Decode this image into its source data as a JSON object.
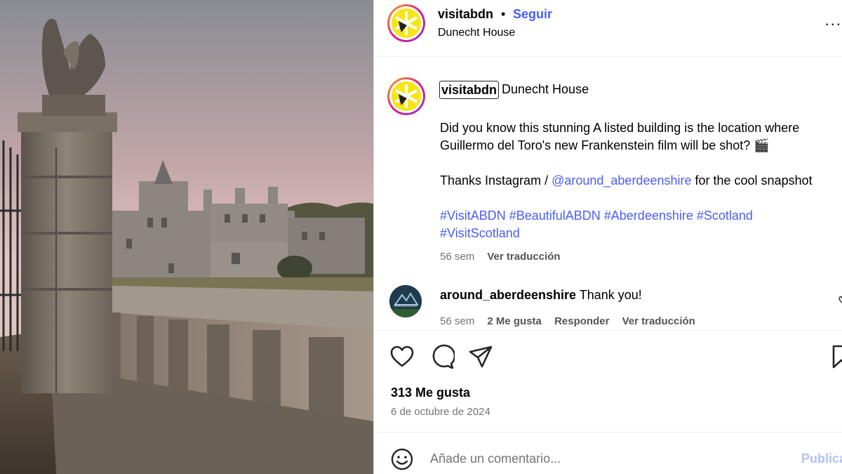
{
  "post": {
    "header": {
      "username": "visitabdn",
      "separator": "•",
      "follow_label": "Seguir",
      "location": "Dunecht House",
      "more_label": "..."
    },
    "caption": {
      "username": "visitabdn",
      "location": "Dunecht House",
      "line1": "Did you know this stunning A listed building is the location where",
      "line2": "Guillermo del Toro's new Frankenstein film will be shot? 🎬",
      "thanks_prefix": "Thanks Instagram / ",
      "mention": "@around_aberdeenshire",
      "thanks_suffix": " for the cool snapshot",
      "hashtags_line1": "#VisitABDN #BeautifulABDN #Aberdeenshire #Scotland",
      "hashtags_line2": "#VisitScotland",
      "time": "56 sem",
      "translate_label": "Ver traducción"
    },
    "comment": {
      "username": "around_aberdeenshire",
      "avatar_label": "Aberdeenshire",
      "text": "Thank you!",
      "time": "56 sem",
      "likes_label": "2 Me gusta",
      "reply_label": "Responder",
      "translate_label": "Ver traducción"
    },
    "actions": {
      "like_icon": "heart-icon",
      "comment_icon": "comment-icon",
      "share_icon": "share-icon",
      "save_icon": "bookmark-icon"
    },
    "likes": "313 Me gusta",
    "date": "6 de octubre de 2024",
    "comment_input": {
      "placeholder": "Añade un comentario...",
      "publish_label": "Publicar"
    }
  },
  "colors": {
    "accent": "#4a5df9",
    "muted": "#737373",
    "publish_disabled": "#b2c0f5",
    "logo_yellow": "#f7e51a"
  }
}
